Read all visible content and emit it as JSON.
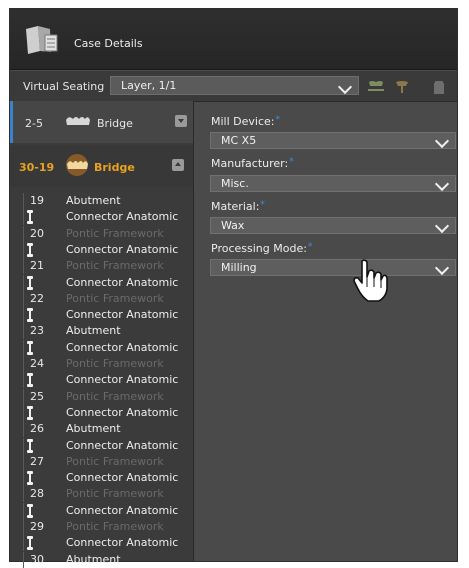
{
  "window": {
    "title": "Case Details"
  },
  "toolbar": {
    "virtual_seating_label": "Virtual Seating",
    "layer_value": "Layer, 1/1",
    "icons": [
      "show-crown-icon",
      "jaw-icon",
      "trash-icon"
    ]
  },
  "bridges": [
    {
      "range": "2-5",
      "name": "Bridge",
      "expanded": false
    },
    {
      "range": "30-19",
      "name": "Bridge",
      "expanded": true,
      "accent": "#e8a21f"
    }
  ],
  "tooth_rows": [
    {
      "num": "19",
      "label": "Abutment",
      "kind": "abutment"
    },
    {
      "num": "",
      "label": "Connector Anatomic",
      "kind": "connector"
    },
    {
      "num": "20",
      "label": "Pontic Framework",
      "kind": "pontic"
    },
    {
      "num": "",
      "label": "Connector Anatomic",
      "kind": "connector"
    },
    {
      "num": "21",
      "label": "Pontic Framework",
      "kind": "pontic"
    },
    {
      "num": "",
      "label": "Connector Anatomic",
      "kind": "connector"
    },
    {
      "num": "22",
      "label": "Pontic Framework",
      "kind": "pontic"
    },
    {
      "num": "",
      "label": "Connector Anatomic",
      "kind": "connector"
    },
    {
      "num": "23",
      "label": "Abutment",
      "kind": "abutment"
    },
    {
      "num": "",
      "label": "Connector Anatomic",
      "kind": "connector"
    },
    {
      "num": "24",
      "label": "Pontic Framework",
      "kind": "pontic"
    },
    {
      "num": "",
      "label": "Connector Anatomic",
      "kind": "connector"
    },
    {
      "num": "25",
      "label": "Pontic Framework",
      "kind": "pontic"
    },
    {
      "num": "",
      "label": "Connector Anatomic",
      "kind": "connector"
    },
    {
      "num": "26",
      "label": "Abutment",
      "kind": "abutment"
    },
    {
      "num": "",
      "label": "Connector Anatomic",
      "kind": "connector"
    },
    {
      "num": "27",
      "label": "Pontic Framework",
      "kind": "pontic"
    },
    {
      "num": "",
      "label": "Connector Anatomic",
      "kind": "connector"
    },
    {
      "num": "28",
      "label": "Pontic Framework",
      "kind": "pontic"
    },
    {
      "num": "",
      "label": "Connector Anatomic",
      "kind": "connector"
    },
    {
      "num": "29",
      "label": "Pontic Framework",
      "kind": "pontic"
    },
    {
      "num": "",
      "label": "Connector Anatomic",
      "kind": "connector"
    },
    {
      "num": "30",
      "label": "Abutment",
      "kind": "abutment"
    }
  ],
  "fields": {
    "mill_device": {
      "label": "Mill Device:",
      "value": "MC X5"
    },
    "manufacturer": {
      "label": "Manufacturer:",
      "value": "Misc."
    },
    "material": {
      "label": "Material:",
      "value": "Wax"
    },
    "processing_mode": {
      "label": "Processing Mode:",
      "value": "Milling"
    },
    "required_marker": "*"
  },
  "colors": {
    "accent_orange": "#e8a21f",
    "required_blue": "#3d8ee6",
    "selection_blue": "#3c82c8"
  }
}
